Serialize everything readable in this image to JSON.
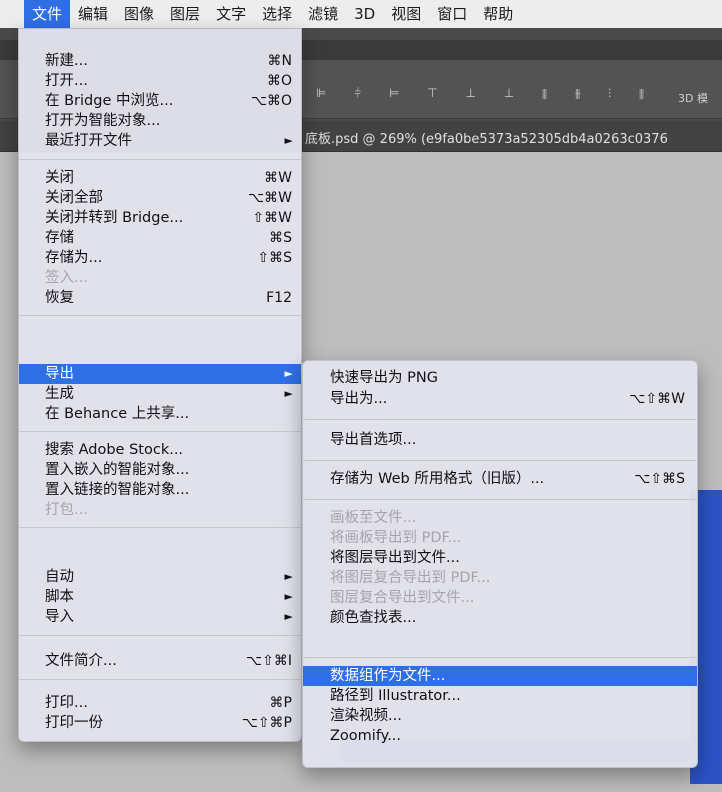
{
  "menubar": [
    "文件",
    "编辑",
    "图像",
    "图层",
    "文字",
    "选择",
    "滤镜",
    "3D",
    "视图",
    "窗口",
    "帮助"
  ],
  "doc_tab_title": "底板.psd @ 269% (e9fa0be5373a52305db4a0263c0376",
  "toolbar_mode": "3D 模",
  "file_menu": {
    "items": [
      {
        "label": "新建...",
        "shortcut": "⌘N"
      },
      {
        "label": "打开...",
        "shortcut": "⌘O"
      },
      {
        "label": "在 Bridge 中浏览...",
        "shortcut": "⌥⌘O"
      },
      {
        "label": "打开为智能对象..."
      },
      {
        "label": "最近打开文件",
        "submenu": "►"
      },
      {
        "label": "关闭",
        "shortcut": "⌘W"
      },
      {
        "label": "关闭全部",
        "shortcut": "⌥⌘W"
      },
      {
        "label": "关闭并转到 Bridge...",
        "shortcut": "⇧⌘W"
      },
      {
        "label": "存储",
        "shortcut": "⌘S"
      },
      {
        "label": "存储为...",
        "shortcut": "⇧⌘S"
      },
      {
        "label": "签入..."
      },
      {
        "label": "恢复",
        "shortcut": "F12"
      },
      {
        "label": "导出",
        "submenu": "►"
      },
      {
        "label": "生成",
        "submenu": "►"
      },
      {
        "label": "在 Behance 上共享..."
      },
      {
        "label": "搜索 Adobe Stock..."
      },
      {
        "label": "置入嵌入的智能对象..."
      },
      {
        "label": "置入链接的智能对象..."
      },
      {
        "label": "打包..."
      },
      {
        "label": "自动",
        "submenu": "►"
      },
      {
        "label": "脚本",
        "submenu": "►"
      },
      {
        "label": "导入",
        "submenu": "►"
      },
      {
        "label": "文件简介...",
        "shortcut": "⌥⇧⌘I"
      },
      {
        "label": "打印...",
        "shortcut": "⌘P"
      },
      {
        "label": "打印一份",
        "shortcut": "⌥⇧⌘P"
      }
    ]
  },
  "export_submenu": {
    "items": [
      {
        "label": "快速导出为 PNG"
      },
      {
        "label": "导出为...",
        "shortcut": "⌥⇧⌘W"
      },
      {
        "label": "导出首选项..."
      },
      {
        "label": "存储为 Web 所用格式（旧版）...",
        "shortcut": "⌥⇧⌘S"
      },
      {
        "label": "画板至文件..."
      },
      {
        "label": "将画板导出到 PDF..."
      },
      {
        "label": "将图层导出到文件..."
      },
      {
        "label": "将图层复合导出到 PDF..."
      },
      {
        "label": "图层复合导出到文件..."
      },
      {
        "label": "颜色查找表..."
      },
      {
        "label": "数据组作为文件..."
      },
      {
        "label": "路径到 Illustrator..."
      },
      {
        "label": "渲染视频..."
      },
      {
        "label": "Zoomify..."
      }
    ]
  }
}
